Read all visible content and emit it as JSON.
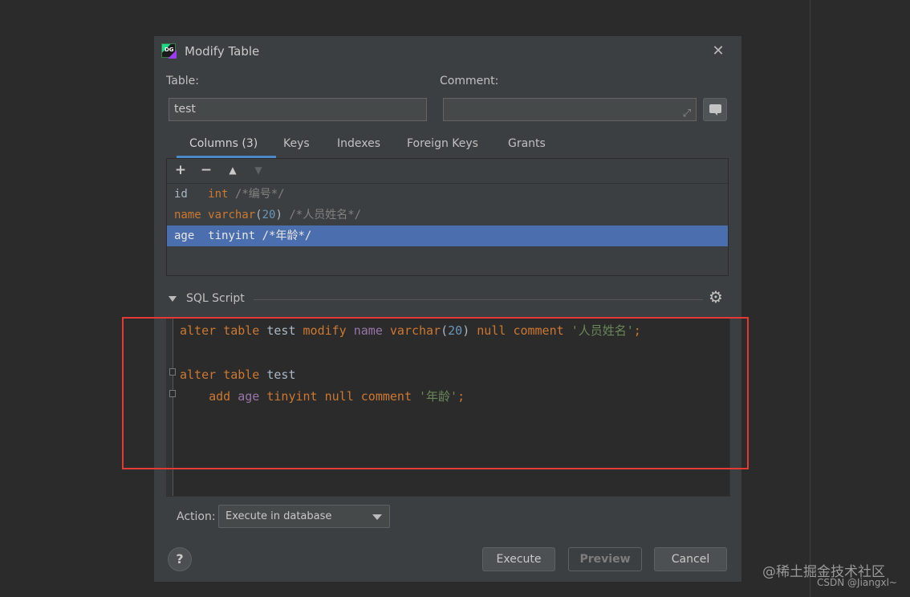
{
  "dialog": {
    "title": "Modify Table",
    "app_icon_text": "DG",
    "close_glyph": "✕"
  },
  "form": {
    "table_label": "Table:",
    "table_value": "test",
    "comment_label": "Comment:",
    "comment_value": ""
  },
  "tabs": [
    {
      "label": "Columns (3)",
      "active": true
    },
    {
      "label": "Keys"
    },
    {
      "label": "Indexes"
    },
    {
      "label": "Foreign Keys"
    },
    {
      "label": "Grants"
    }
  ],
  "columns_toolbar": {
    "add": "+",
    "remove": "−",
    "move_up": "▲",
    "move_down": "▼"
  },
  "columns": [
    {
      "name": "id",
      "pad": "   ",
      "type": "int",
      "comment": "/*编号*/"
    },
    {
      "name": "name",
      "type_kw": "varchar",
      "size": "20",
      "comment": "/*人员姓名*/"
    },
    {
      "name": "age",
      "pad": "  ",
      "type": "tinyint",
      "comment": "/*年龄*/",
      "selected": true
    }
  ],
  "sql_section": {
    "title": "SQL Script",
    "gear_glyph": "⚙"
  },
  "sql": {
    "line1": {
      "alter": "alter",
      "table": "table",
      "tbl": "test",
      "modify": "modify",
      "col": "name",
      "type": "varchar",
      "size": "20",
      "null": "null",
      "comment": "comment",
      "str": "'人员姓名'",
      "semi": ";"
    },
    "line3": {
      "alter": "alter",
      "table": "table",
      "tbl": "test"
    },
    "line4": {
      "add": "add",
      "col": "age",
      "type": "tinyint",
      "null": "null",
      "comment": "comment",
      "str": "'年龄'",
      "semi": ";"
    }
  },
  "action": {
    "label": "Action:",
    "selected": "Execute in database"
  },
  "buttons": {
    "help": "?",
    "execute": "Execute",
    "preview": "Preview",
    "cancel": "Cancel"
  },
  "watermark": {
    "line1": "@稀土掘金技术社区",
    "line2": "CSDN @Jiangxl~"
  },
  "colors": {
    "selection": "#4b6eaf",
    "keyword": "#cc7832",
    "number": "#6897bb",
    "string": "#6a8759",
    "annotation_box": "#e53935",
    "tab_underline": "#4a88c7"
  }
}
